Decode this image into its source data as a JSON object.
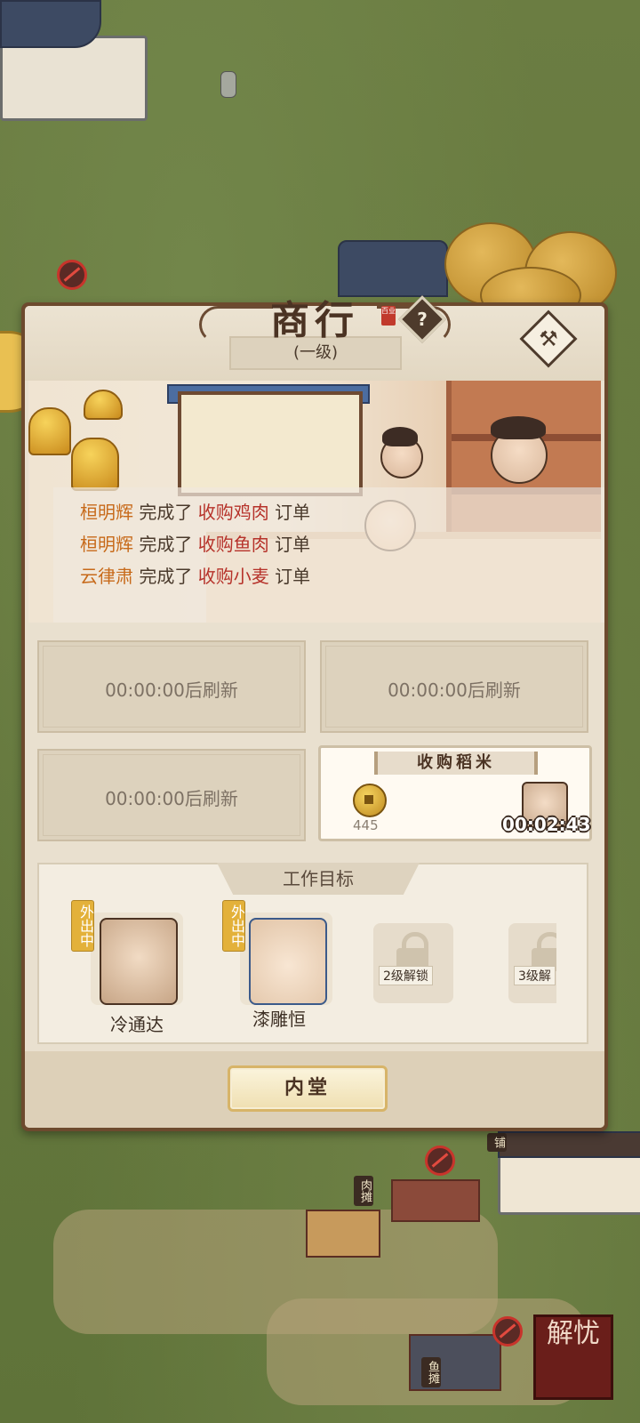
{
  "panel": {
    "title": "商行",
    "seal_text": "百业",
    "help_symbol": "?",
    "level": "(一级)"
  },
  "activity_log": [
    {
      "name": "桓明辉",
      "verb": "完成了",
      "item": "收购鸡肉",
      "suffix": "订单"
    },
    {
      "name": "桓明辉",
      "verb": "完成了",
      "item": "收购鱼肉",
      "suffix": "订单"
    },
    {
      "name": "云律肃",
      "verb": "完成了",
      "item": "收购小麦",
      "suffix": "订单"
    }
  ],
  "orders": {
    "refresh_slots": [
      "00:00:00后刷新",
      "00:00:00后刷新",
      "00:00:00后刷新"
    ],
    "active_order": {
      "title": "收购稻米",
      "reward": "445",
      "timer": "00:02:43"
    }
  },
  "work_target": {
    "tab_label": "工作目标",
    "members": [
      {
        "name": "冷通达",
        "status": "外出中"
      },
      {
        "name": "漆雕恒",
        "status": "外出中"
      }
    ],
    "locked": [
      "2级解锁",
      "3级解"
    ]
  },
  "footer": {
    "inner_hall_label": "内堂"
  },
  "map": {
    "stall_meat": "肉摊",
    "stall_fish": "鱼摊",
    "shop_sign": "铺",
    "jieyou_label": "解忧"
  },
  "colors": {
    "panel_frame": "#6d4a2e",
    "log_name": "#c76a1a",
    "log_item": "#b6322a",
    "badge": "#e3b13a"
  }
}
